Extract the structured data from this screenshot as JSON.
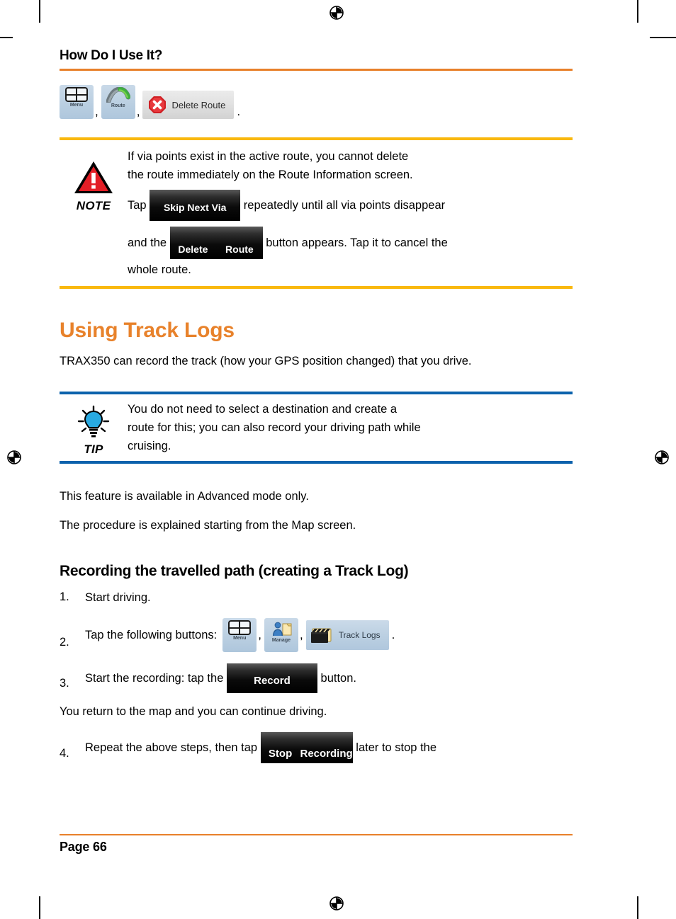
{
  "running_head": "How Do I Use It?",
  "top_buttons": {
    "menu_label": "Menu",
    "route_label": "Route",
    "delete_route_label": "Delete Route",
    "comma": ",",
    "period": "."
  },
  "note_callout": {
    "icon_label": "NOTE",
    "line1": "If via points exist in the active route, you cannot delete",
    "line2": "the route immediately on the Route Information screen.",
    "tap_word": "Tap ",
    "skip_next_via_button": "Skip Next Via",
    "after_skip": " repeatedly until all via points disappear",
    "and_the_word": "and the ",
    "delete_route_button_line1": "Delete",
    "delete_route_button_line2": "Route",
    "after_delete": " button appears. Tap it to cancel the",
    "line_last": "whole route."
  },
  "section": {
    "title": "Using Track Logs",
    "intro": "TRAX350 can record the track (how your GPS position changed) that you drive."
  },
  "tip_callout": {
    "icon_label": "TIP",
    "line1": "You do not need to select a destination and create a",
    "line2": "route for this; you can also record your driving path while",
    "line3": "cruising."
  },
  "paragraphs": {
    "advanced_mode": "This feature is available in Advanced mode only.",
    "procedure": "The procedure is explained starting from the Map screen."
  },
  "subsection": {
    "title": "Recording the travelled path (creating a Track Log)"
  },
  "steps": [
    {
      "number": "1.",
      "text": "Start driving."
    },
    {
      "number": "2.",
      "text": "Tap the following buttons:",
      "menu_label": "Menu",
      "manage_label": "Manage",
      "track_logs_label": "Track Logs",
      "comma": ",",
      "period": "."
    },
    {
      "number": "3.",
      "text_before": "Start the recording: tap the ",
      "button": "Record",
      "text_after": " button."
    },
    {
      "number": "4.",
      "text_before": "Repeat the above steps, then tap ",
      "button_line1": "Stop",
      "button_line2": "Recording",
      "text_after": " later to stop the"
    }
  ],
  "interstitial": "You return to the map and you can continue driving.",
  "footer": {
    "page_label": "Page 66"
  },
  "colors": {
    "orange_rule": "#E8802A",
    "heading_orange": "#E8822B",
    "note_yellow": "#F9B80E",
    "tip_blue": "#0B62AC",
    "warning_red": "#E31E26",
    "bulb_cyan": "#29AAE2"
  }
}
